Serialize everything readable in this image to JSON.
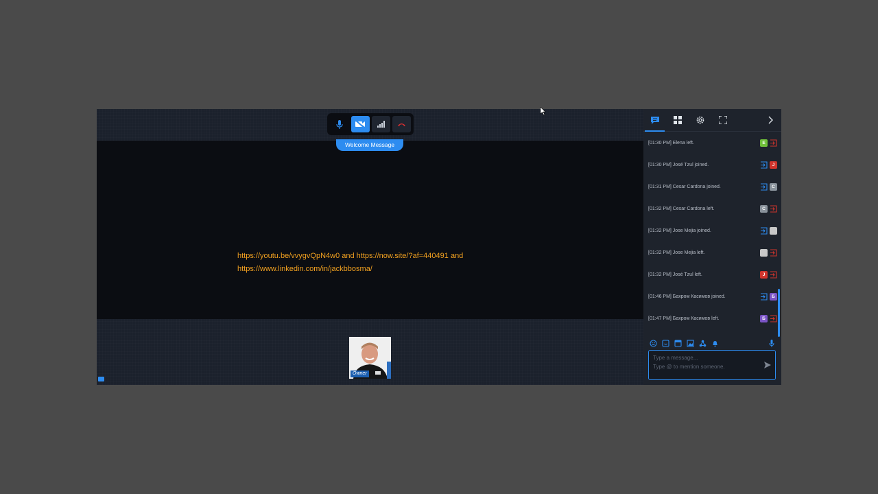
{
  "controls": {
    "mic": "microphone-icon",
    "camera": "camera-off-icon",
    "signal": "signal-icon",
    "hangup": "end-call-icon"
  },
  "welcome_tab": "Welcome Message",
  "message": {
    "line1": "https://youtu.be/vvygvQpN4w0 and https://now.site/?af=440491 and",
    "line2": "https://www.linkedin.com/in/jackbbosma/"
  },
  "participant": {
    "role": "Owner"
  },
  "panel": {
    "tabs": [
      "chat-icon",
      "grid-icon",
      "settings-icon",
      "fullscreen-icon"
    ],
    "log": [
      {
        "text": "[01:30 PM] Elena left.",
        "type": "left",
        "initial": "E",
        "color": "#6fbf3a"
      },
      {
        "text": "[01:30 PM] José Tzul joined.",
        "type": "joined",
        "initial": "J",
        "color": "#d0342c"
      },
      {
        "text": "[01:31 PM] Cesar Cardona joined.",
        "type": "joined",
        "initial": "C",
        "color": "#8a939c"
      },
      {
        "text": "[01:32 PM] Cesar Cardona left.",
        "type": "left",
        "initial": "C",
        "color": "#8a939c"
      },
      {
        "text": "[01:32 PM] Jose Mejia joined.",
        "type": "joined",
        "initial": "",
        "color": "#c8c8c8"
      },
      {
        "text": "[01:32 PM] Jose Mejia left.",
        "type": "left",
        "initial": "",
        "color": "#c8c8c8"
      },
      {
        "text": "[01:32 PM] José Tzul left.",
        "type": "left",
        "initial": "J",
        "color": "#d0342c"
      },
      {
        "text": "[01:46 PM] Бахром Касимов joined.",
        "type": "joined",
        "initial": "Б",
        "color": "#7b55c7"
      },
      {
        "text": "[01:47 PM] Бахром Касимов left.",
        "type": "left",
        "initial": "Б",
        "color": "#7b55c7"
      }
    ],
    "composer": {
      "placeholder": "Type a message...",
      "hint": "Type @ to mention someone."
    }
  }
}
